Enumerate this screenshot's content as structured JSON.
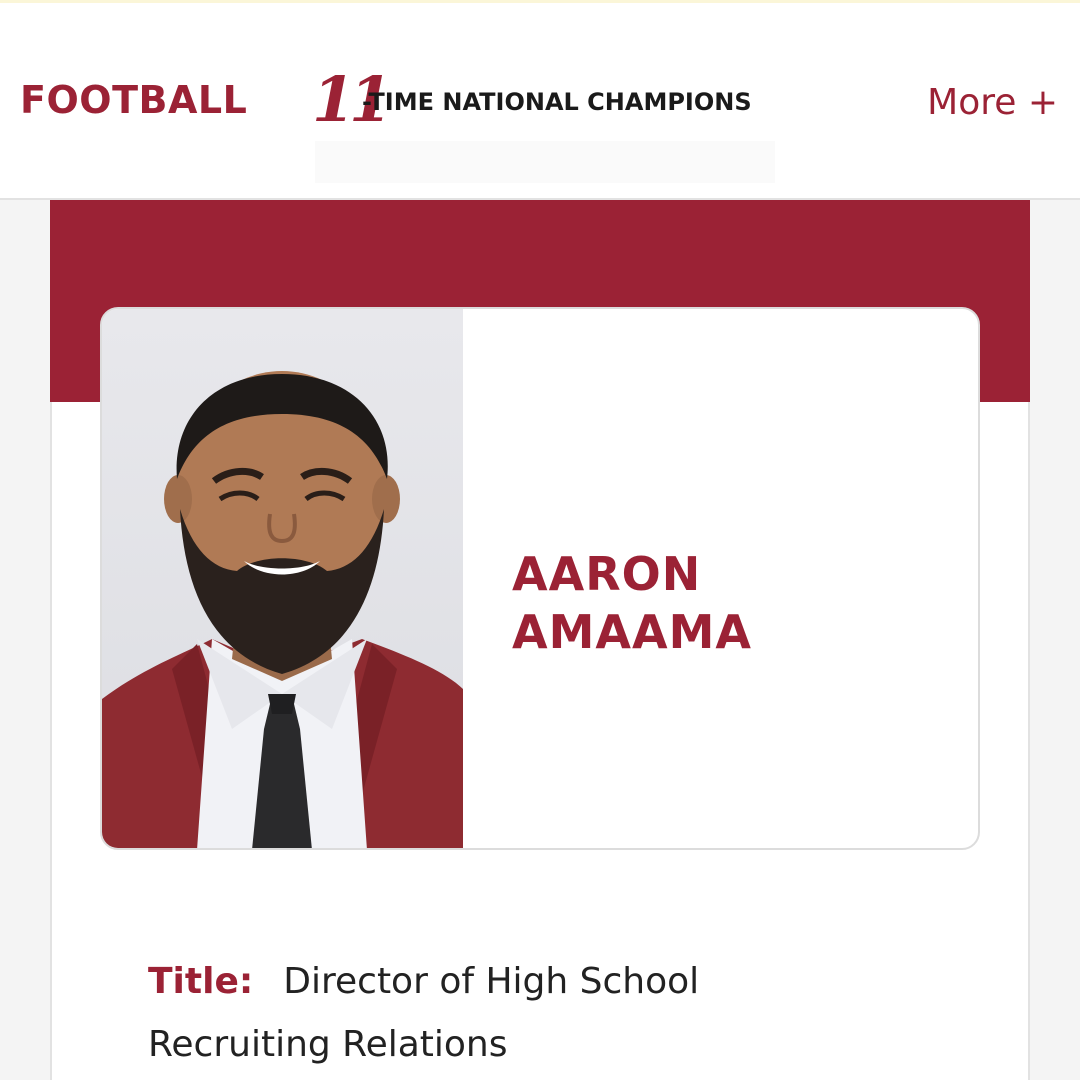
{
  "nav": {
    "title": "FOOTBALL",
    "champions_number": "11",
    "champions_text": "-TIME NATIONAL CHAMPIONS",
    "more_label": "More +"
  },
  "profile": {
    "first_name": "AARON",
    "last_name": "AMAAMA",
    "photo_icon": "staff-headshot-photo",
    "title_label": "Title:",
    "title_value": "Director of High School Recruiting Relations"
  },
  "colors": {
    "brand": "#9b2235",
    "text": "#222222",
    "background": "#f4f4f4"
  }
}
